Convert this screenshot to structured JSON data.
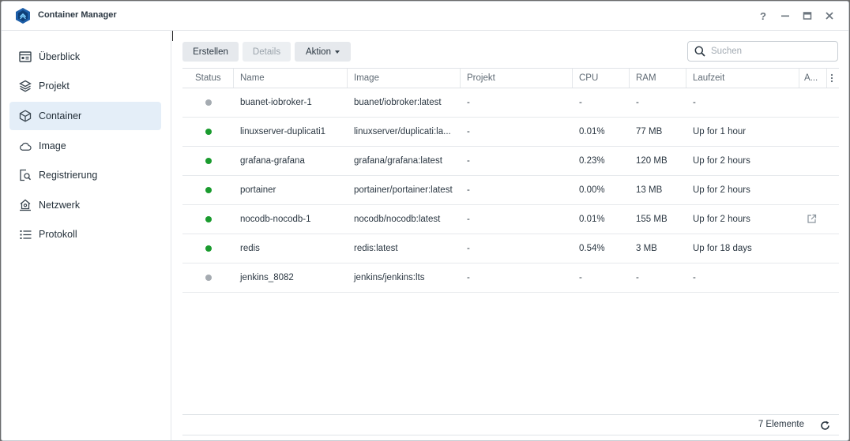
{
  "window": {
    "title": "Container Manager",
    "controls": [
      "help-icon",
      "minimize-icon",
      "maximize-icon",
      "close-icon"
    ],
    "help_label": "?"
  },
  "sidebar": {
    "items": [
      {
        "label": "Überblick",
        "icon": "overview-icon",
        "active": false
      },
      {
        "label": "Projekt",
        "icon": "layers-icon",
        "active": false
      },
      {
        "label": "Container",
        "icon": "cube-icon",
        "active": true
      },
      {
        "label": "Image",
        "icon": "cloud-icon",
        "active": false
      },
      {
        "label": "Registrierung",
        "icon": "registry-search-icon",
        "active": false
      },
      {
        "label": "Netzwerk",
        "icon": "network-icon",
        "active": false
      },
      {
        "label": "Protokoll",
        "icon": "list-icon",
        "active": false
      }
    ]
  },
  "toolbar": {
    "create_label": "Erstellen",
    "details_label": "Details",
    "action_label": "Aktion"
  },
  "search": {
    "placeholder": "Suchen",
    "value": ""
  },
  "table": {
    "columns": [
      "Status",
      "Name",
      "Image",
      "Projekt",
      "CPU",
      "RAM",
      "Laufzeit",
      "A..."
    ],
    "rows": [
      {
        "status": "stopped",
        "name": "buanet-iobroker-1",
        "image": "buanet/iobroker:latest",
        "project": "-",
        "cpu": "-",
        "ram": "-",
        "uptime": "-",
        "link": false
      },
      {
        "status": "running",
        "name": "linuxserver-duplicati1",
        "image": "linuxserver/duplicati:la...",
        "project": "-",
        "cpu": "0.01%",
        "ram": "77 MB",
        "uptime": "Up for 1 hour",
        "link": false
      },
      {
        "status": "running",
        "name": "grafana-grafana",
        "image": "grafana/grafana:latest",
        "project": "-",
        "cpu": "0.23%",
        "ram": "120 MB",
        "uptime": "Up for 2 hours",
        "link": false
      },
      {
        "status": "running",
        "name": "portainer",
        "image": "portainer/portainer:latest",
        "project": "-",
        "cpu": "0.00%",
        "ram": "13 MB",
        "uptime": "Up for 2 hours",
        "link": false
      },
      {
        "status": "running",
        "name": "nocodb-nocodb-1",
        "image": "nocodb/nocodb:latest",
        "project": "-",
        "cpu": "0.01%",
        "ram": "155 MB",
        "uptime": "Up for 2 hours",
        "link": true
      },
      {
        "status": "running",
        "name": "redis",
        "image": "redis:latest",
        "project": "-",
        "cpu": "0.54%",
        "ram": "3 MB",
        "uptime": "Up for 18 days",
        "link": false
      },
      {
        "status": "stopped",
        "name": "jenkins_8082",
        "image": "jenkins/jenkins:lts",
        "project": "-",
        "cpu": "-",
        "ram": "-",
        "uptime": "-",
        "link": false
      }
    ]
  },
  "footer": {
    "count_label": "7 Elemente"
  },
  "colors": {
    "running": "#1a9b2e",
    "stopped": "#a5abb1",
    "active_nav": "#e4eef8"
  }
}
